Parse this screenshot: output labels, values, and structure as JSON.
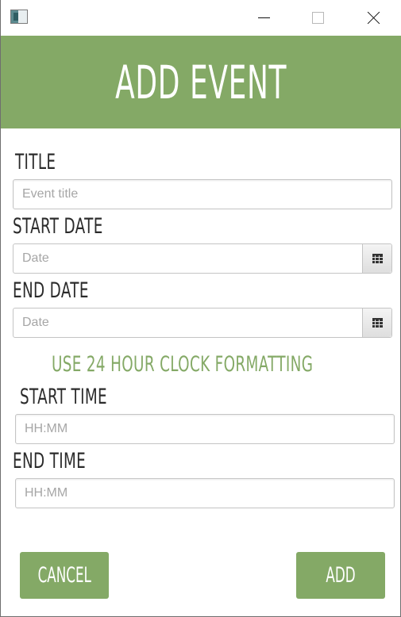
{
  "window": {
    "controls": {
      "minimize": "minimize-icon",
      "maximize": "maximize-icon",
      "close": "close-icon"
    },
    "app_icon": "app-icon"
  },
  "header": {
    "title": "ADD EVENT",
    "background": "#84a966"
  },
  "form": {
    "title_label": "TITLE",
    "title_placeholder": "Event title",
    "start_date_label": "START DATE",
    "start_date_placeholder": "Date",
    "end_date_label": "END DATE",
    "end_date_placeholder": "Date",
    "calendar_icon": "calendar-icon",
    "time_hint": "USE 24 HOUR CLOCK FORMATTING",
    "start_time_label": "START TIME",
    "start_time_placeholder": "HH:MM",
    "end_time_label": "END TIME",
    "end_time_placeholder": "HH:MM"
  },
  "actions": {
    "cancel_label": "CANCEL",
    "add_label": "ADD"
  },
  "colors": {
    "accent": "#84a966",
    "label_text": "#2b2b2b",
    "placeholder": "#a6a6a6"
  }
}
